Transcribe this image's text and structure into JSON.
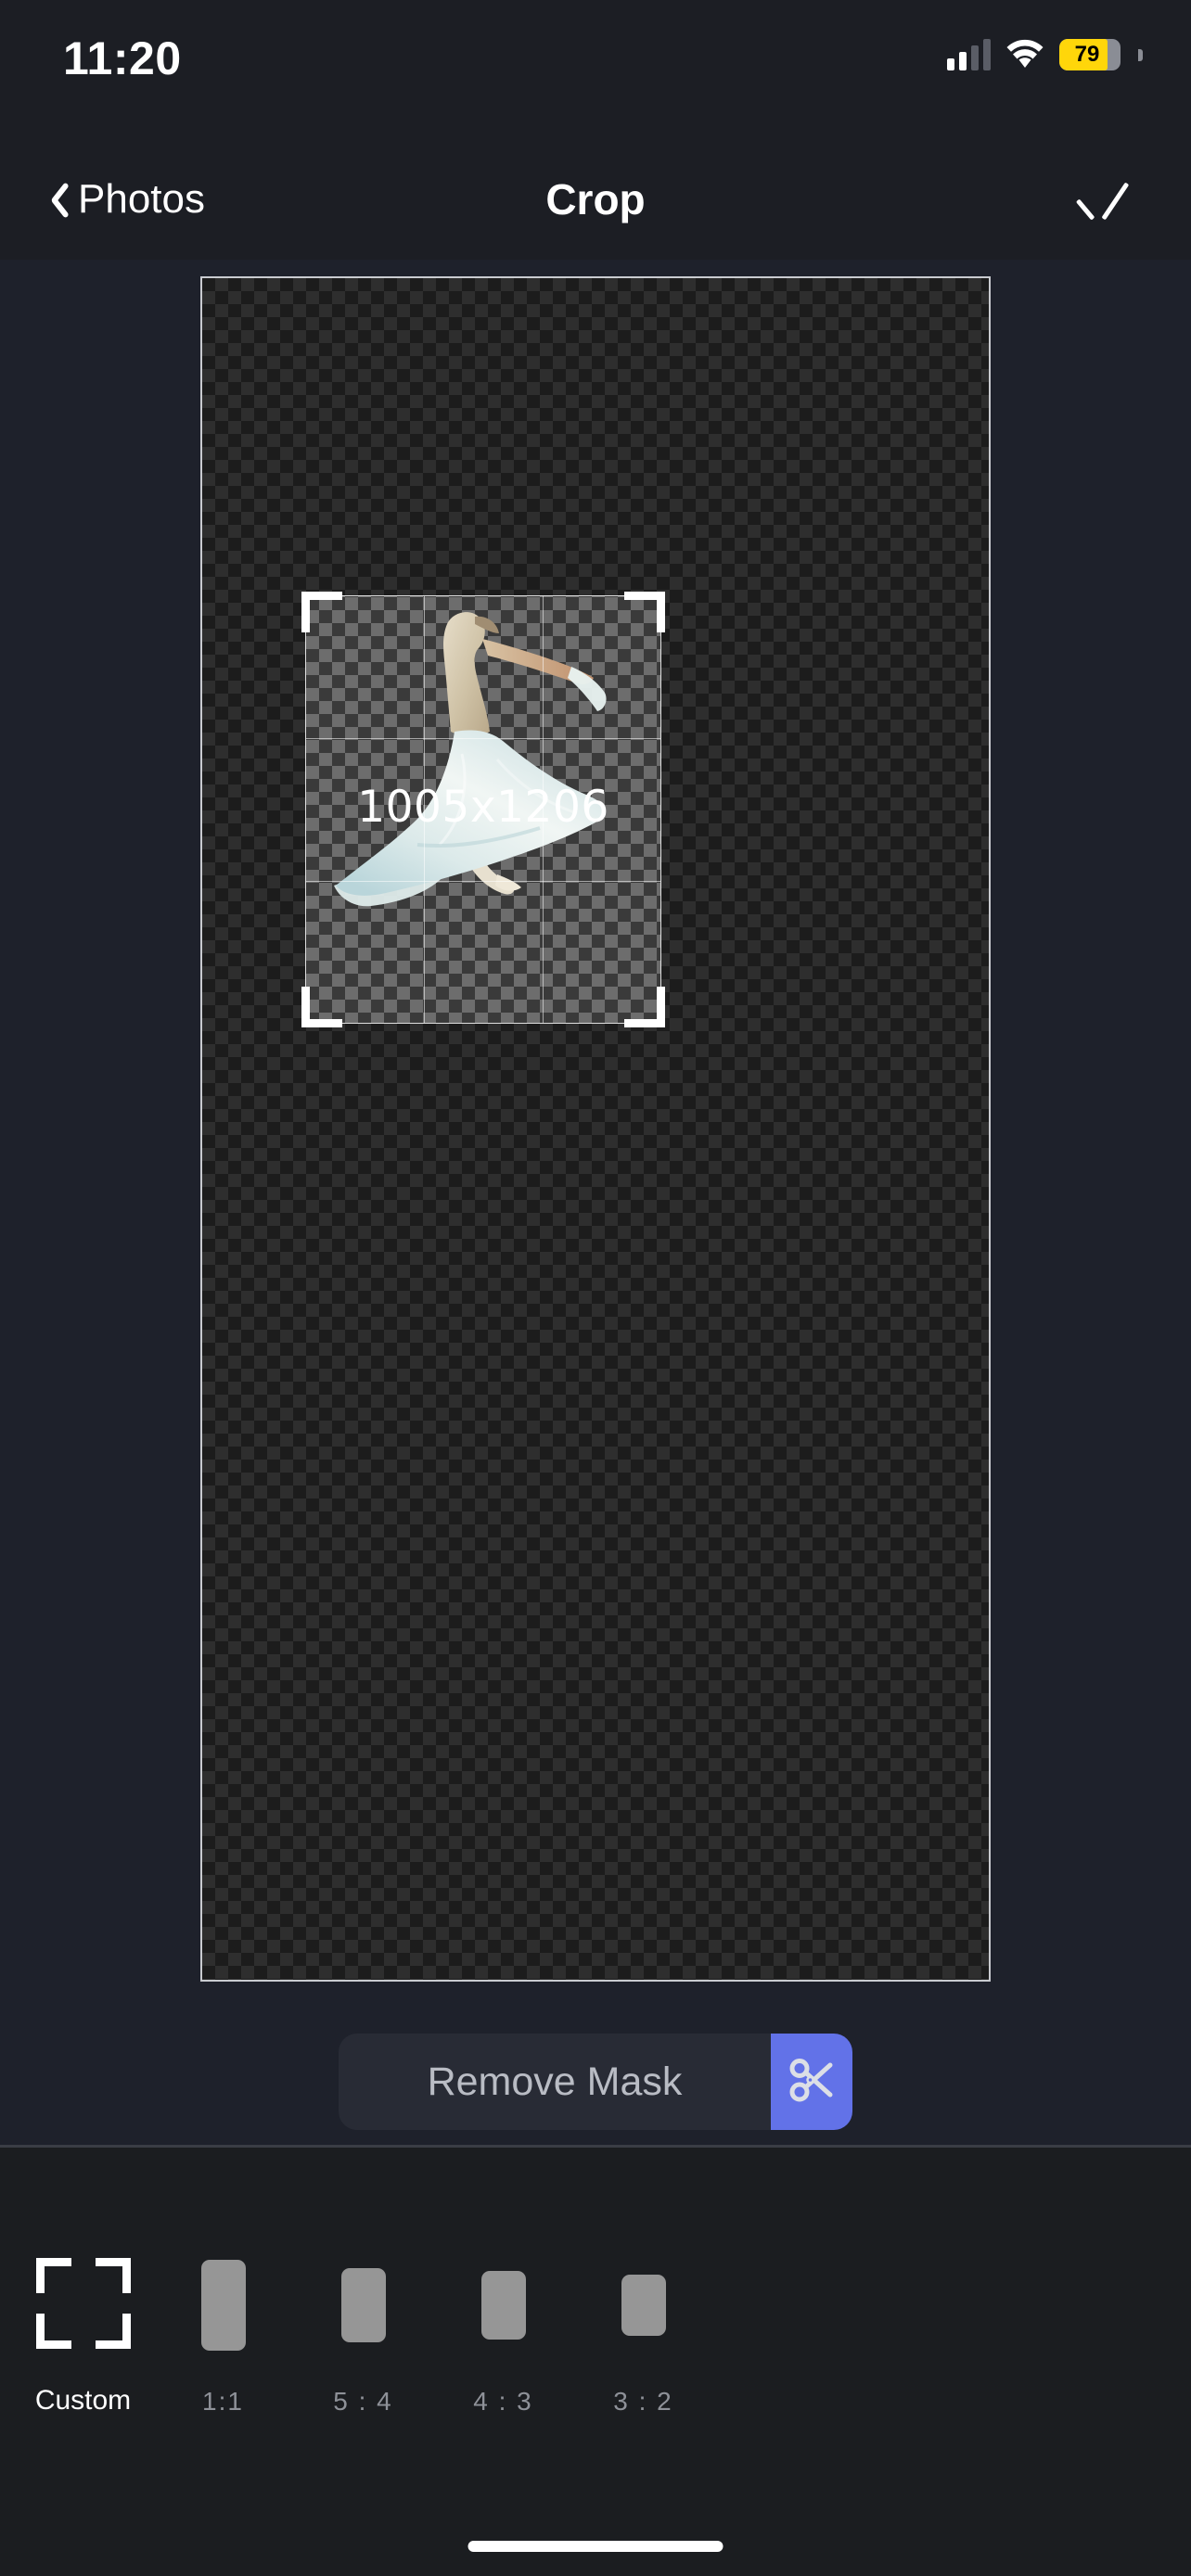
{
  "status_bar": {
    "time": "11:20",
    "battery_percent": "79",
    "battery_level": 79,
    "battery_color": "#FFD60A",
    "signal_bars_filled": 2,
    "signal_bars_total": 4,
    "wifi_icon": "wifi-icon"
  },
  "nav_bar": {
    "back_label": "Photos",
    "back_icon": "chevron-left-icon",
    "title": "Crop",
    "done_icon": "checkmark-icon"
  },
  "editor": {
    "crop_dimensions_label": "1005x1206",
    "crop_width": 1005,
    "crop_height": 1206,
    "grid_overlay": "rule-of-thirds",
    "transparency_checkerboard": true,
    "subject_description": "cut-out of a dancer in a pale blue flowing dress seen from behind"
  },
  "mask_tools": {
    "remove_mask_label": "Remove Mask",
    "scissors_icon": "scissors-icon",
    "scissors_button_color": "#6272E8"
  },
  "aspect_panel": {
    "selected": "Custom",
    "items": [
      {
        "label": "Custom",
        "icon": "crop-corners-icon",
        "swatch_w": 0,
        "swatch_h": 0
      },
      {
        "label": "1:1",
        "icon": "aspect-swatch",
        "swatch_w": 48,
        "swatch_h": 98
      },
      {
        "label": "5 : 4",
        "icon": "aspect-swatch",
        "swatch_w": 48,
        "swatch_h": 80
      },
      {
        "label": "4 : 3",
        "icon": "aspect-swatch",
        "swatch_w": 48,
        "swatch_h": 74
      },
      {
        "label": "3 : 2",
        "icon": "aspect-swatch",
        "swatch_w": 48,
        "swatch_h": 66
      }
    ]
  },
  "home_indicator": "home-indicator"
}
